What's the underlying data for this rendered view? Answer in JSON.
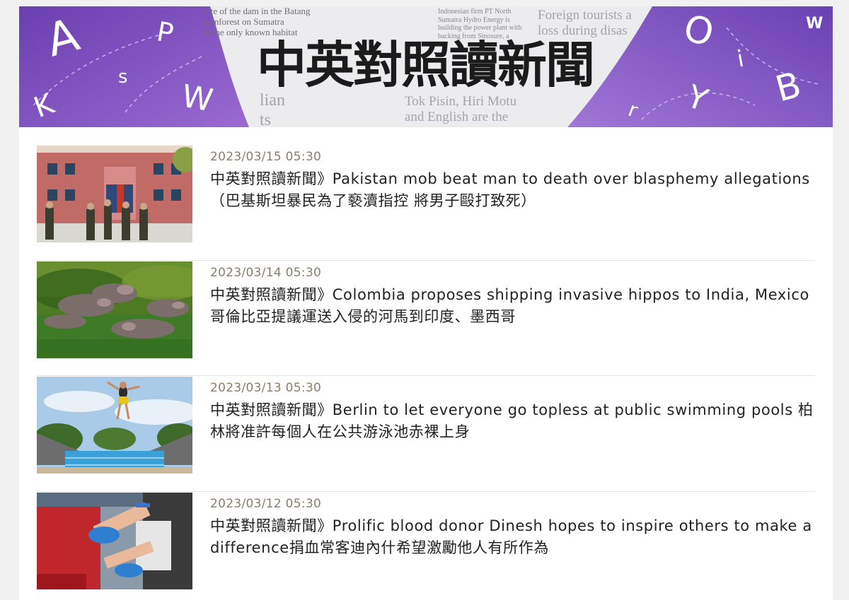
{
  "banner": {
    "title": "中英對照讀新聞",
    "letters": [
      "A",
      "P",
      "s",
      "K",
      "W",
      "O",
      "W",
      "i",
      "B",
      "Y",
      "r"
    ],
    "paper_text": {
      "left_top": [
        "site of the dam in the Batang",
        "rainforest on Sumatra",
        "is the only known habitat"
      ],
      "right_top": [
        "Foreign tourists a",
        "loss during disas"
      ],
      "center_top_small": [
        "Indonesian firm PT North",
        "Sumatra Hydro Energy is",
        "building the power plant with",
        "backing from Sinosure, a"
      ],
      "left_bottom": [
        "lian",
        "ts"
      ],
      "center_bottom": [
        "Tok Pisin, Hiri Motu",
        "and English are the"
      ]
    }
  },
  "articles": [
    {
      "date": "2023/03/15 05:30",
      "title": "中英對照讀新聞》Pakistan mob beat man to death over blasphemy allegations （巴基斯坦暴民為了褻瀆指控 將男子毆打致死）",
      "image": "police-in-front-of-building"
    },
    {
      "date": "2023/03/14 05:30",
      "title": "中英對照讀新聞》Colombia proposes shipping invasive hippos to India, Mexico 哥倫比亞提議運送入侵的河馬到印度、墨西哥",
      "image": "hippos-in-water"
    },
    {
      "date": "2023/03/13 05:30",
      "title": "中英對照讀新聞》Berlin to let everyone go topless at public swimming pools 柏林將准許每個人在公共游泳池赤裸上身",
      "image": "jumper-over-swimming-pool"
    },
    {
      "date": "2023/03/12 05:30",
      "title": "中英對照讀新聞》Prolific blood donor Dinesh hopes to inspire others to make a difference捐血常客迪內什希望激勵他人有所作為",
      "image": "blood-donation"
    }
  ],
  "colors": {
    "banner_purple": "#7d4fb8",
    "date_color": "#8b7d6b",
    "title_color": "#222222"
  }
}
